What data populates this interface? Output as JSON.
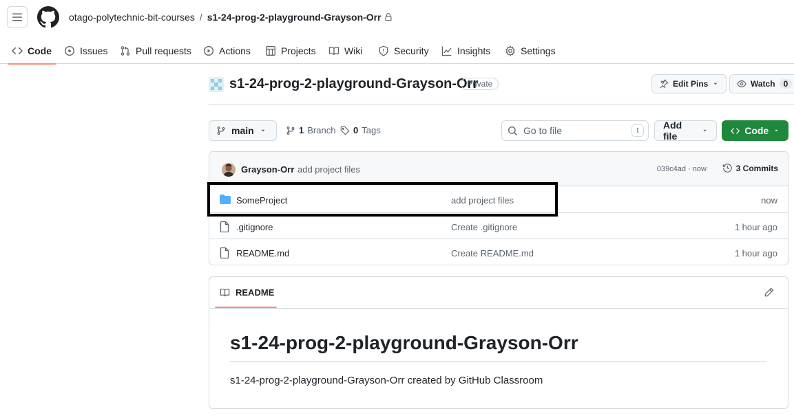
{
  "header": {
    "owner": "otago-polytechnic-bit-courses",
    "separator": "/",
    "repo": "s1-24-prog-2-playground-Grayson-Orr"
  },
  "tabs": [
    {
      "label": "Code",
      "icon": "code-icon",
      "active": true
    },
    {
      "label": "Issues",
      "icon": "issue-icon"
    },
    {
      "label": "Pull requests",
      "icon": "pull-request-icon"
    },
    {
      "label": "Actions",
      "icon": "play-icon"
    },
    {
      "label": "Projects",
      "icon": "table-icon"
    },
    {
      "label": "Wiki",
      "icon": "book-icon"
    },
    {
      "label": "Security",
      "icon": "shield-icon"
    },
    {
      "label": "Insights",
      "icon": "graph-icon"
    },
    {
      "label": "Settings",
      "icon": "gear-icon"
    }
  ],
  "repo": {
    "name": "s1-24-prog-2-playground-Grayson-Orr",
    "visibility": "Private",
    "edit_pins": "Edit Pins",
    "watch": "Watch",
    "watch_count": "0"
  },
  "toolbar": {
    "branch": "main",
    "branches_count": "1",
    "branches_label": "Branch",
    "tags_count": "0",
    "tags_label": "Tags",
    "goto_placeholder": "Go to file",
    "goto_shortcut": "t",
    "add_file": "Add file",
    "code": "Code"
  },
  "commit": {
    "author": "Grayson-Orr",
    "message": "add project files",
    "hash_time": "039c4ad · now",
    "commits": "3 Commits"
  },
  "files": [
    {
      "name": "SomeProject",
      "type": "folder",
      "message": "add project files",
      "age": "now"
    },
    {
      "name": ".gitignore",
      "type": "file",
      "message": "Create .gitignore",
      "age": "1 hour ago"
    },
    {
      "name": "README.md",
      "type": "file",
      "message": "Create README.md",
      "age": "1 hour ago"
    }
  ],
  "readme": {
    "tab": "README",
    "heading": "s1-24-prog-2-playground-Grayson-Orr",
    "body": "s1-24-prog-2-playground-Grayson-Orr created by GitHub Classroom"
  },
  "colors": {
    "accent_underline": "#fd8c73",
    "code_button": "#1f883d",
    "folder": "#54aeff",
    "highlight_box": "#000000"
  }
}
